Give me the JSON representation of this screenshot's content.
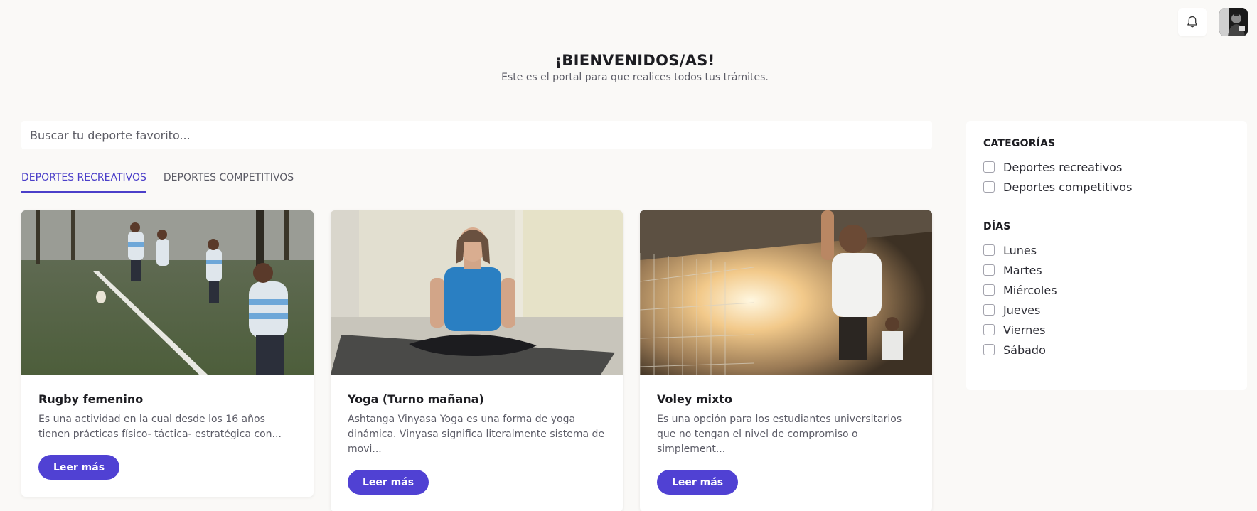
{
  "header": {
    "title": "¡BIENVENIDOS/AS!",
    "subtitle": "Este es el portal para que realices todos tus trámites."
  },
  "topbar": {
    "notification_icon": "bell-icon",
    "avatar": "user-avatar"
  },
  "search": {
    "placeholder": "Buscar tu deporte favorito..."
  },
  "tabs": [
    {
      "label": "DEPORTES RECREATIVOS",
      "active": true
    },
    {
      "label": "DEPORTES COMPETITIVOS",
      "active": false
    }
  ],
  "cards": [
    {
      "title": "Rugby femenino",
      "description": "Es una actividad en la cual desde los 16 años tienen prácticas físico- táctica- estratégica con...",
      "button_label": "Leer más"
    },
    {
      "title": "Yoga (Turno mañana)",
      "description": "Ashtanga Vinyasa Yoga es una forma de yoga dinámica. Vinyasa significa literalmente sistema de movi...",
      "button_label": "Leer más"
    },
    {
      "title": "Voley mixto",
      "description": "Es una opción para los estudiantes universitarios que no tengan el nivel de compromiso o simplement...",
      "button_label": "Leer más"
    }
  ],
  "filters": {
    "categories": {
      "title": "CATEGORÍAS",
      "items": [
        "Deportes recreativos",
        "Deportes competitivos"
      ]
    },
    "days": {
      "title": "DÍAS",
      "items": [
        "Lunes",
        "Martes",
        "Miércoles",
        "Jueves",
        "Viernes",
        "Sábado"
      ]
    }
  },
  "colors": {
    "accent": "#5041d3",
    "background": "#faf9f7"
  }
}
